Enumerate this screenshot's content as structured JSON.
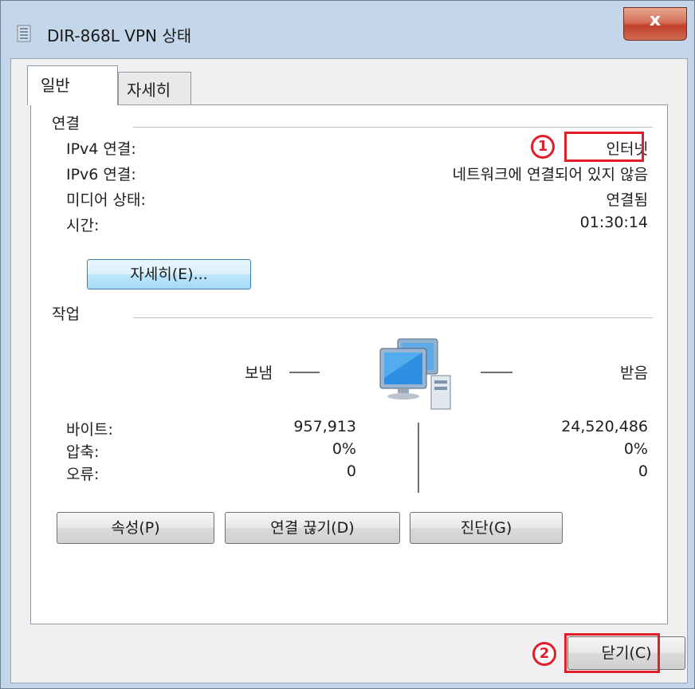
{
  "window": {
    "title": "DIR-868L VPN 상태",
    "close_label": "x"
  },
  "tabs": [
    {
      "label": "일반"
    },
    {
      "label": "자세히"
    }
  ],
  "connection": {
    "group_title": "연결",
    "rows": [
      {
        "label": "IPv4 연결:",
        "value": "인터넷"
      },
      {
        "label": "IPv6 연결:",
        "value": "네트워크에 연결되어 있지 않음"
      },
      {
        "label": "미디어 상태:",
        "value": "연결됨"
      },
      {
        "label": "시간:",
        "value": "01:30:14"
      }
    ],
    "details_button": "자세히(E)..."
  },
  "activity": {
    "group_title": "작업",
    "sent_label": "보냄",
    "received_label": "받음",
    "rows": [
      {
        "label": "바이트:",
        "sent": "957,913",
        "received": "24,520,486"
      },
      {
        "label": "압축:",
        "sent": "0%",
        "received": "0%"
      },
      {
        "label": "오류:",
        "sent": "0",
        "received": "0"
      }
    ]
  },
  "buttons": {
    "properties": "속성(P)",
    "disconnect": "연결 끊기(D)",
    "diagnose": "진단(G)",
    "close": "닫기(C)"
  },
  "annotations": {
    "marker1": "1",
    "marker2": "2",
    "color": "#e01f2b"
  },
  "icons": {
    "title": "network-connection-icon",
    "activity": "network-computers-icon"
  }
}
